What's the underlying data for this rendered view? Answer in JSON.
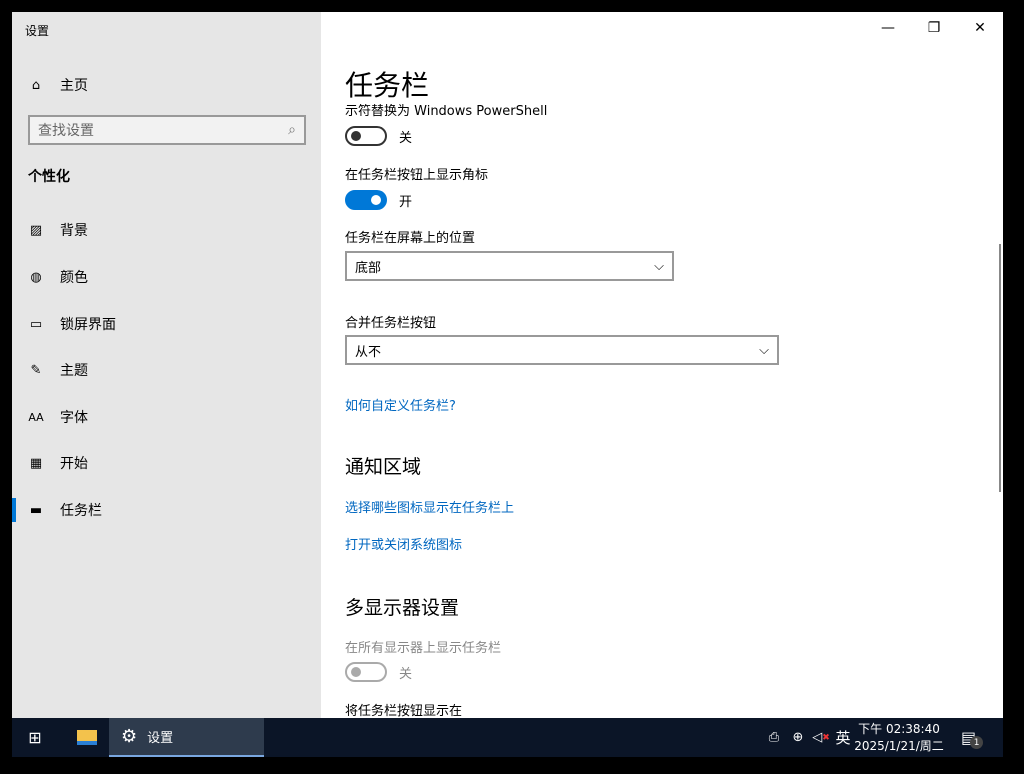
{
  "window": {
    "title": "设置",
    "minimize": "—",
    "maximize": "❐",
    "close": "✕"
  },
  "sidebar": {
    "home": "主页",
    "search_placeholder": "查找设置",
    "section": "个性化",
    "items": [
      {
        "label": "背景",
        "icon": "image-icon"
      },
      {
        "label": "颜色",
        "icon": "palette-icon"
      },
      {
        "label": "锁屏界面",
        "icon": "lock-screen-icon"
      },
      {
        "label": "主题",
        "icon": "theme-icon"
      },
      {
        "label": "字体",
        "icon": "font-icon"
      },
      {
        "label": "开始",
        "icon": "start-icon"
      },
      {
        "label": "任务栏",
        "icon": "taskbar-icon",
        "selected": true
      }
    ]
  },
  "main": {
    "title": "任务栏",
    "powershell_label": "示符替换为 Windows PowerShell",
    "powershell_state": "关",
    "badges_label": "在任务栏按钮上显示角标",
    "badges_state": "开",
    "position_label": "任务栏在屏幕上的位置",
    "position_value": "底部",
    "combine_label": "合并任务栏按钮",
    "combine_value": "从不",
    "customize_link": "如何自定义任务栏?",
    "notify_heading": "通知区域",
    "notify_link1": "选择哪些图标显示在任务栏上",
    "notify_link2": "打开或关闭系统图标",
    "multi_heading": "多显示器设置",
    "multi_show_label": "在所有显示器上显示任务栏",
    "multi_show_state": "关",
    "multi_buttons_label": "将任务栏按钮显示在"
  },
  "taskbar": {
    "app_label": "设置",
    "ime": "英",
    "time": "下午 02:38:40",
    "date": "2025/1/21/周二",
    "notification_count": "1"
  },
  "colors": {
    "accent": "#0078d7",
    "link": "#0067c0",
    "taskbar": "#0b1527"
  }
}
